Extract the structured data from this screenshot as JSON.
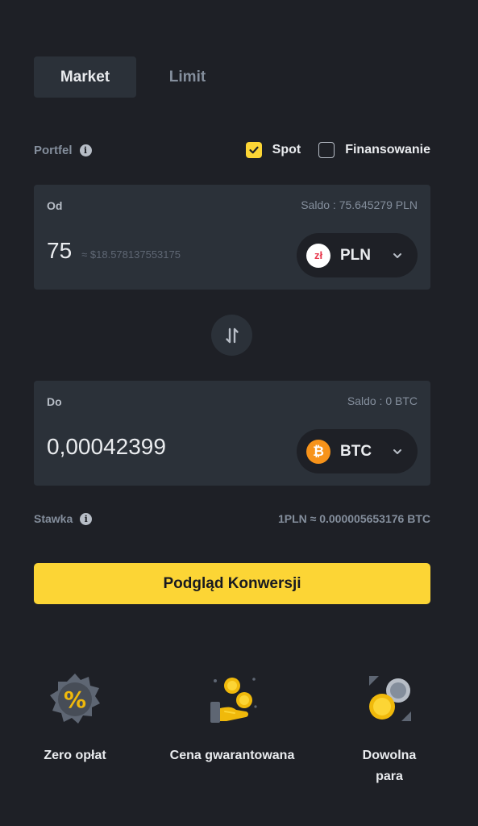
{
  "tabs": [
    {
      "label": "Market",
      "active": true
    },
    {
      "label": "Limit",
      "active": false
    }
  ],
  "wallet": {
    "label": "Portfel",
    "options": [
      {
        "label": "Spot",
        "checked": true
      },
      {
        "label": "Finansowanie",
        "checked": false
      }
    ]
  },
  "from": {
    "label": "Od",
    "balance": "Saldo : 75.645279 PLN",
    "amount": "75",
    "approx": "≈ $18.578137553175",
    "coin": "PLN",
    "coin_symbol": "zł"
  },
  "to": {
    "label": "Do",
    "balance": "Saldo : 0 BTC",
    "amount": "0,00042399",
    "coin": "BTC",
    "coin_symbol": "₿"
  },
  "rate": {
    "label": "Stawka",
    "value": "1PLN ≈ 0.000005653176 BTC"
  },
  "preview_button": "Podgląd Konwersji",
  "features": [
    {
      "icon": "zero-fee-percent-icon",
      "lines": [
        "Zero opłat"
      ]
    },
    {
      "icon": "guaranteed-price-hand-coins-icon",
      "lines": [
        "Cena gwarantowana"
      ]
    },
    {
      "icon": "any-pair-coins-icon",
      "lines": [
        "Dowolna",
        "para"
      ]
    }
  ],
  "colors": {
    "background": "#1e2026",
    "panel": "#2b3139",
    "accent": "#fcd535",
    "muted": "#848e9c",
    "btc": "#f7931a"
  }
}
